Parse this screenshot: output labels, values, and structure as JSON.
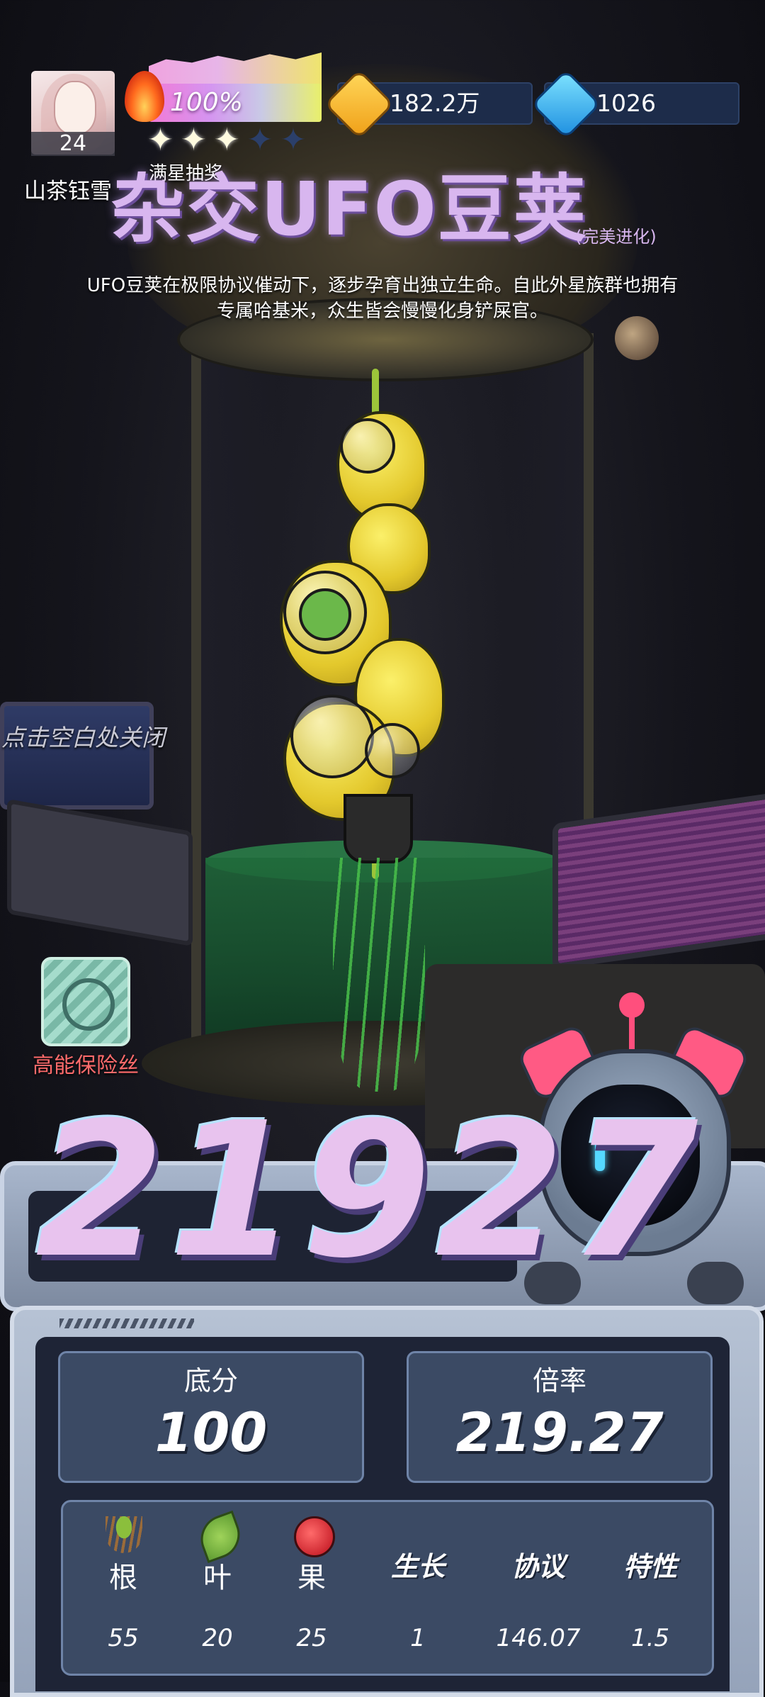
{
  "player": {
    "name": "山茶钰雪",
    "level": "24"
  },
  "heat": {
    "percent": "100%",
    "stars_filled": 3,
    "stars_total": 5,
    "label": "满星抽奖"
  },
  "currency": {
    "coins": "182.2万",
    "gems": "1026"
  },
  "plant": {
    "title": "杂交UFO豆荚",
    "suffix": "(完美进化)",
    "description_line1": "UFO豆荚在极限协议催动下，逐步孕育出独立生命。自此外星族群也拥有",
    "description_line2": "专属哈基米，众生皆会慢慢化身铲屎官。"
  },
  "hints": {
    "close": "点击空白处关闭"
  },
  "fuse": {
    "label": "高能保险丝"
  },
  "score": {
    "total": "21927",
    "base_label": "底分",
    "base_value": "100",
    "multiplier_label": "倍率",
    "multiplier_value": "219.27"
  },
  "details": [
    {
      "label": "根",
      "value": "55",
      "icon": "root-icon"
    },
    {
      "label": "叶",
      "value": "20",
      "icon": "leaf-icon"
    },
    {
      "label": "果",
      "value": "25",
      "icon": "apple-icon"
    },
    {
      "label": "生长",
      "value": "1",
      "icon": ""
    },
    {
      "label": "协议",
      "value": "146.07",
      "icon": ""
    },
    {
      "label": "特性",
      "value": "1.5",
      "icon": ""
    }
  ],
  "colors": {
    "accent_purple": "#d8b6ef",
    "fuse_red": "#ff6b6b",
    "panel_blue": "#3b4a64"
  }
}
